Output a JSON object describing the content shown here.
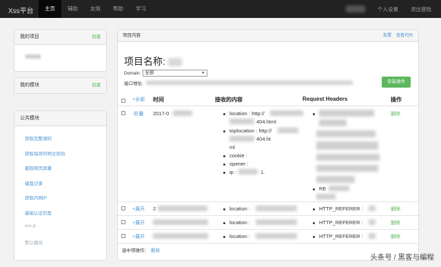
{
  "nav": {
    "brand": "Xss平台",
    "items": [
      {
        "label": "主页",
        "active": true
      },
      {
        "label": "辅助",
        "active": false
      },
      {
        "label": "友情",
        "active": false
      },
      {
        "label": "帮助",
        "active": false
      },
      {
        "label": "学习",
        "active": false
      }
    ],
    "right": {
      "settings": "个人设置",
      "logout": "退出登陆"
    }
  },
  "sidebar": {
    "my_projects": {
      "title": "我的项目",
      "action": "创建"
    },
    "my_modules": {
      "title": "我的模块",
      "action": "创建"
    },
    "public_modules": {
      "title": "公共模块",
      "items": [
        "获取完整源码",
        "获取保存的明文密码",
        "截取网页屏幕",
        "键盘记录",
        "获取内网IP",
        "基础认证钓鱼",
        "xss.js",
        "默认模块"
      ]
    }
  },
  "main": {
    "header": "项目内容",
    "header_links": [
      "配置",
      "查看代码"
    ],
    "title": "项目名称:",
    "domain_label": "Domain:",
    "domain_value": "全部",
    "api_label": "接口地址:",
    "install_button": "安装插件",
    "table": {
      "headers": {
        "select_all": "+全部",
        "time": "时间",
        "content": "接收的内容",
        "request_headers": "Request Headers",
        "action": "操作"
      },
      "expanded_row": {
        "toggle": "-折叠",
        "time": "2017-0",
        "content": [
          {
            "label": "location : http://",
            "tail": "404.html"
          },
          {
            "label": "toplocation : http://",
            "tail": "404.ht",
            "extra": "ml"
          },
          {
            "label": "cookie :"
          },
          {
            "label": "opener :"
          },
          {
            "label": "ip :",
            "tail": "1."
          }
        ],
        "headers": [
          {
            "label": "",
            "tail": "RE"
          }
        ],
        "delete": "删除"
      },
      "collapsed_rows": [
        {
          "toggle": "+展开",
          "time": "2",
          "content": "location :",
          "headers": "HTTP_REFERER :",
          "delete": "删除"
        },
        {
          "toggle": "+展开",
          "time": "",
          "content": "location :",
          "headers": "HTTP_REFERER :",
          "delete": "删除"
        },
        {
          "toggle": "+展开",
          "time": "",
          "content": "location :",
          "headers": "HTTP_REFERER :",
          "delete": "删除"
        }
      ]
    },
    "footer": {
      "label": "选中项操作：",
      "delete": "删除"
    }
  },
  "watermark": "头条号 / 黑客与编程"
}
